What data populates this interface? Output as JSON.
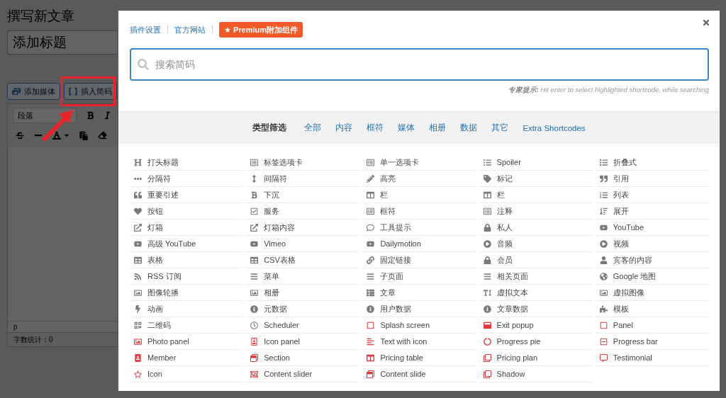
{
  "editor": {
    "page_title": "撰写新文章",
    "title_field": {
      "placeholder": "添加标题"
    },
    "media_buttons": [
      "添加媒体",
      "插入简码"
    ],
    "format_select": "段落",
    "status_path": "p",
    "word_count": "字数统计：0"
  },
  "dialog": {
    "header_links": [
      "插件设置",
      "官方网站"
    ],
    "premium_button": "★ Premium附加组件",
    "search": {
      "placeholder": "搜索简码"
    },
    "tip": "**专家提示:** Hit enter to select highlighted shortcode, while searching",
    "filter": {
      "label": "类型筛选",
      "options": [
        "全部",
        "内容",
        "框符",
        "媒体",
        "相册",
        "数据",
        "其它",
        "Extra Shortcodes"
      ]
    },
    "shortcodes": [
      {
        "label": "打头标题",
        "kind": "core"
      },
      {
        "label": "标签选项卡",
        "kind": "core"
      },
      {
        "label": "单一选项卡",
        "kind": "core"
      },
      {
        "label": "Spoiler",
        "kind": "core"
      },
      {
        "label": "折叠式",
        "kind": "core"
      },
      {
        "label": "分隔符",
        "kind": "core"
      },
      {
        "label": "间隔符",
        "kind": "core"
      },
      {
        "label": "高亮",
        "kind": "core"
      },
      {
        "label": "标记",
        "kind": "core"
      },
      {
        "label": "引用",
        "kind": "core"
      },
      {
        "label": "重要引述",
        "kind": "core"
      },
      {
        "label": "下沉",
        "kind": "core"
      },
      {
        "label": "栏",
        "kind": "core"
      },
      {
        "label": "栏",
        "kind": "core"
      },
      {
        "label": "列表",
        "kind": "core"
      },
      {
        "label": "按钮",
        "kind": "core"
      },
      {
        "label": "服务",
        "kind": "core"
      },
      {
        "label": "框符",
        "kind": "core"
      },
      {
        "label": "注释",
        "kind": "core"
      },
      {
        "label": "展开",
        "kind": "core"
      },
      {
        "label": "灯箱",
        "kind": "core"
      },
      {
        "label": "灯箱内容",
        "kind": "core"
      },
      {
        "label": "工具提示",
        "kind": "core"
      },
      {
        "label": "私人",
        "kind": "core"
      },
      {
        "label": "YouTube",
        "kind": "core"
      },
      {
        "label": "高级 YouTube",
        "kind": "core"
      },
      {
        "label": "Vimeo",
        "kind": "core"
      },
      {
        "label": "Dailymotion",
        "kind": "core"
      },
      {
        "label": "音频",
        "kind": "core"
      },
      {
        "label": "视频",
        "kind": "core"
      },
      {
        "label": "表格",
        "kind": "core"
      },
      {
        "label": "CSV表格",
        "kind": "core"
      },
      {
        "label": "固定链接",
        "kind": "core"
      },
      {
        "label": "会员",
        "kind": "core"
      },
      {
        "label": "宾客的内容",
        "kind": "core"
      },
      {
        "label": "RSS 订阅",
        "kind": "core"
      },
      {
        "label": "菜单",
        "kind": "core"
      },
      {
        "label": "子页面",
        "kind": "core"
      },
      {
        "label": "相关页面",
        "kind": "core"
      },
      {
        "label": "Google 地图",
        "kind": "core"
      },
      {
        "label": "图像轮播",
        "kind": "core"
      },
      {
        "label": "相册",
        "kind": "core"
      },
      {
        "label": "文章",
        "kind": "core"
      },
      {
        "label": "虚拟文本",
        "kind": "core"
      },
      {
        "label": "虚拟图像",
        "kind": "core"
      },
      {
        "label": "动画",
        "kind": "core"
      },
      {
        "label": "元数据",
        "kind": "core"
      },
      {
        "label": "用户数据",
        "kind": "core"
      },
      {
        "label": "文章数据",
        "kind": "core"
      },
      {
        "label": "模板",
        "kind": "core"
      },
      {
        "label": "二维码",
        "kind": "core"
      },
      {
        "label": "Scheduler",
        "kind": "core"
      },
      {
        "label": "Splash screen",
        "kind": "extra"
      },
      {
        "label": "Exit popup",
        "kind": "extra"
      },
      {
        "label": "Panel",
        "kind": "extra"
      },
      {
        "label": "Photo panel",
        "kind": "extra"
      },
      {
        "label": "Icon panel",
        "kind": "extra"
      },
      {
        "label": "Text with icon",
        "kind": "extra"
      },
      {
        "label": "Progress pie",
        "kind": "extra"
      },
      {
        "label": "Progress bar",
        "kind": "extra"
      },
      {
        "label": "Member",
        "kind": "extra"
      },
      {
        "label": "Section",
        "kind": "extra"
      },
      {
        "label": "Pricing table",
        "kind": "extra"
      },
      {
        "label": "Pricing plan",
        "kind": "extra"
      },
      {
        "label": "Testimonial",
        "kind": "extra"
      },
      {
        "label": "Icon",
        "kind": "extra"
      },
      {
        "label": "Content slider",
        "kind": "extra"
      },
      {
        "label": "Content slide",
        "kind": "extra"
      },
      {
        "label": "Shadow",
        "kind": "extra"
      }
    ]
  }
}
